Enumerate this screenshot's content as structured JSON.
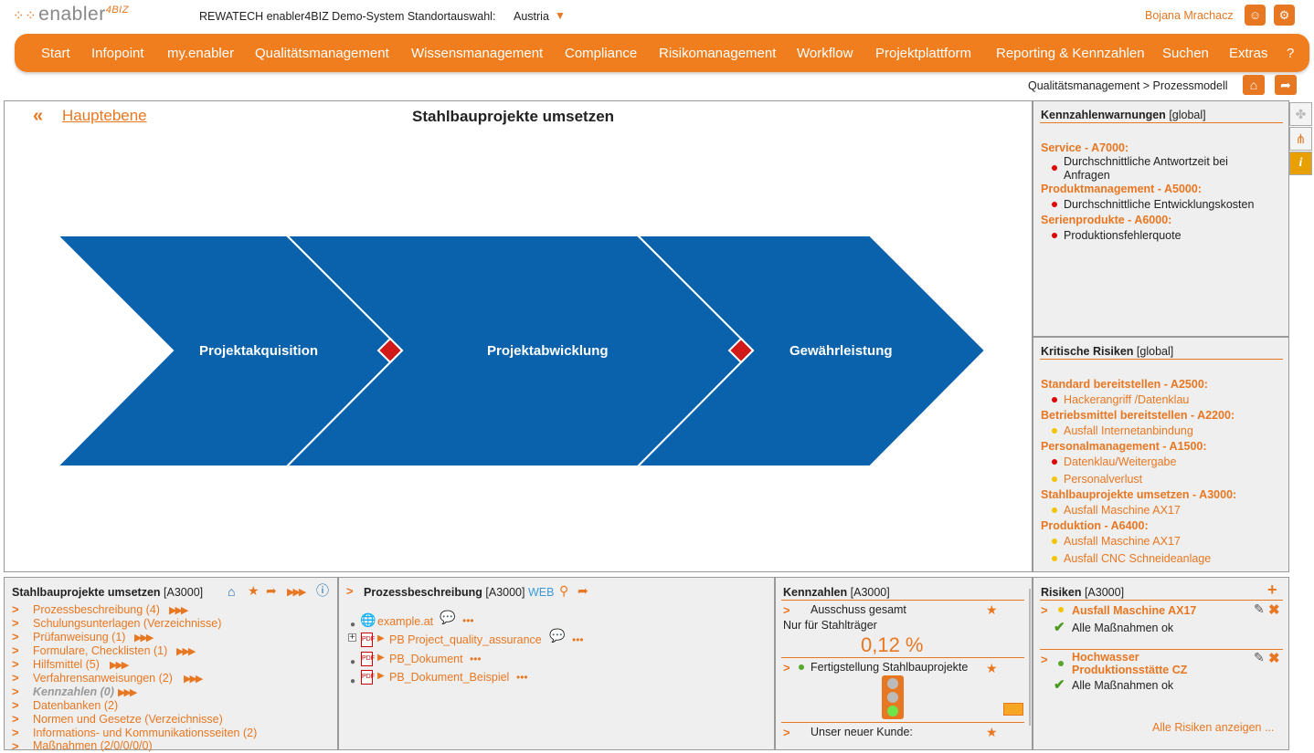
{
  "app": {
    "logo_text": "enabler",
    "logo_sup": "4BIZ",
    "system_title": "REWATECH enabler4BIZ Demo-System Standortauswahl:",
    "site": "Austria",
    "user": "Bojana Mrachacz"
  },
  "nav": [
    "Start",
    "Infopoint",
    "my.enabler",
    "Qualitätsmanagement",
    "Wissensmanagement",
    "Compliance",
    "Risikomanagement",
    "Workflow",
    "Projektplattform",
    "Reporting & Kennzahlen",
    "Suchen",
    "Extras",
    "?"
  ],
  "breadcrumb": "Qualitätsmanagement > Prozessmodell",
  "process": {
    "back_label": "Hauptebene",
    "title": "Stahlbauprojekte umsetzen",
    "steps": [
      "Projektakquisition",
      "Projektabwicklung",
      "Gewährleistung"
    ],
    "colors": {
      "step": "#0a62ad",
      "connector": "#d01a1a"
    }
  },
  "kennzahlen_warnings": {
    "title": "Kennzahlenwarnungen",
    "scope": "[global]",
    "groups": [
      {
        "name": "Service - A7000:",
        "items": [
          "Durchschnittliche Antwortzeit bei Anfragen"
        ]
      },
      {
        "name": "Produktmanagement - A5000:",
        "items": [
          "Durchschnittliche Entwicklungskosten"
        ]
      },
      {
        "name": "Serienprodukte - A6000:",
        "items": [
          "Produktionsfehlerquote"
        ]
      }
    ]
  },
  "critical_risks": {
    "title": "Kritische Risiken",
    "scope": "[global]",
    "groups": [
      {
        "name": "Standard bereitstellen - A2500:",
        "items": [
          {
            "label": "Hackerangriff /Datenklau",
            "level": "red"
          }
        ]
      },
      {
        "name": "Betriebsmittel bereitstellen - A2200:",
        "items": [
          {
            "label": "Ausfall Internetanbindung",
            "level": "yellow"
          }
        ]
      },
      {
        "name": "Personalmanagement - A1500:",
        "items": [
          {
            "label": "Datenklau/Weitergabe",
            "level": "red"
          },
          {
            "label": "Personalverlust",
            "level": "yellow"
          }
        ]
      },
      {
        "name": "Stahlbauprojekte umsetzen - A3000:",
        "items": [
          {
            "label": "Ausfall Maschine AX17",
            "level": "yellow"
          }
        ]
      },
      {
        "name": "Produktion - A6400:",
        "items": [
          {
            "label": "Ausfall Maschine AX17",
            "level": "yellow"
          },
          {
            "label": "Ausfall CNC Schneideanlage",
            "level": "yellow"
          }
        ]
      }
    ]
  },
  "nav_panel": {
    "title": "Stahlbauprojekte umsetzen",
    "id": "[A3000]",
    "items": [
      "Prozessbeschreibung (4)",
      "Schulungsunterlagen (Verzeichnisse)",
      "Prüfanweisung (1)",
      "Formulare, Checklisten (1)",
      "Hilfsmittel (5)",
      "Verfahrensanweisungen (2)",
      "Kennzahlen (0)",
      "Datenbanken (2)",
      "Normen und Gesetze (Verzeichnisse)",
      "Informations- und Kommunikationsseiten (2)",
      "Maßnahmen (2/0/0/0/0)"
    ]
  },
  "docs_panel": {
    "title": "Prozessbeschreibung",
    "id": "[A3000]",
    "web": "WEB",
    "items": [
      "example.at",
      "PB Project_quality_assurance",
      "PB_Dokument",
      "PB_Dokument_Beispiel"
    ]
  },
  "kpi_panel": {
    "title": "Kennzahlen",
    "id": "[A3000]",
    "kpi1_name": "Ausschuss gesamt",
    "kpi1_desc": "Nur für Stahlträger",
    "kpi1_value": "0,12 %",
    "kpi2_name": "Fertigstellung Stahlbauprojekte",
    "kpi3_name": "Unser neuer Kunde:"
  },
  "risk_panel": {
    "title": "Risiken",
    "id": "[A3000]",
    "r1_name": "Ausfall Maschine AX17",
    "r1_status": "Alle Maßnahmen ok",
    "r2_name": "Hochwasser Produktionsstätte CZ",
    "r2_status": "Alle Maßnahmen ok",
    "show_all": "Alle Risiken anzeigen ..."
  }
}
